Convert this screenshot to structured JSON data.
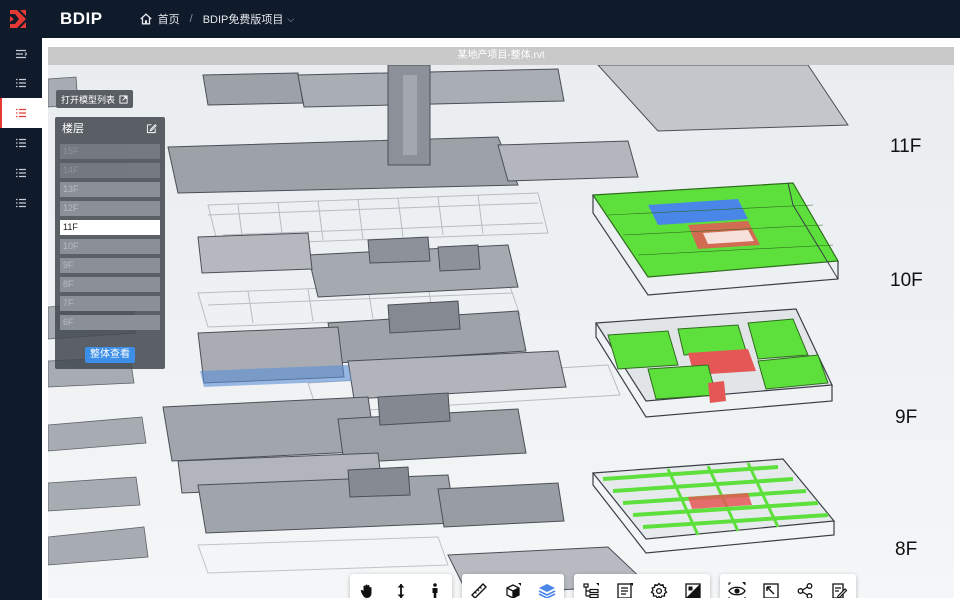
{
  "app": {
    "name": "BDIP",
    "brand_color": "#e53935"
  },
  "breadcrumb": {
    "home_label": "首页",
    "separator": "/",
    "project_label": "BDIP免费版项目"
  },
  "sidebar": {
    "items": [
      "menu-collapse-icon",
      "list-icon",
      "list-icon",
      "list-icon",
      "list-icon",
      "list-icon"
    ],
    "active_index": 2
  },
  "viewer": {
    "title": "某地产项目-整体.rvt",
    "open_model_list": "打开模型列表"
  },
  "floor_panel": {
    "title": "楼层",
    "floors": [
      "15F",
      "14F",
      "13F",
      "12F",
      "11F",
      "10F",
      "9F",
      "8F",
      "7F",
      "6F"
    ],
    "selected": "11F",
    "whole_view_button": "整体查看"
  },
  "floor_labels": [
    "11F",
    "10F",
    "9F",
    "8F"
  ],
  "toolbar": {
    "groups": [
      [
        "hand-icon",
        "vertical-move-icon",
        "person-walk-icon"
      ],
      [
        "ruler-icon",
        "section-box-icon",
        "layers-icon"
      ],
      [
        "structure-tree-icon",
        "properties-icon",
        "settings-gear-icon",
        "render-mode-icon"
      ],
      [
        "visibility-icon",
        "fit-view-icon",
        "share-icon",
        "markup-icon"
      ]
    ],
    "active_tool": "layers-icon"
  },
  "colors": {
    "highlight_green": "#5de03c",
    "highlight_red": "#e55757",
    "highlight_blue": "#4a86e8",
    "accent_blue": "#3c8ee8"
  }
}
